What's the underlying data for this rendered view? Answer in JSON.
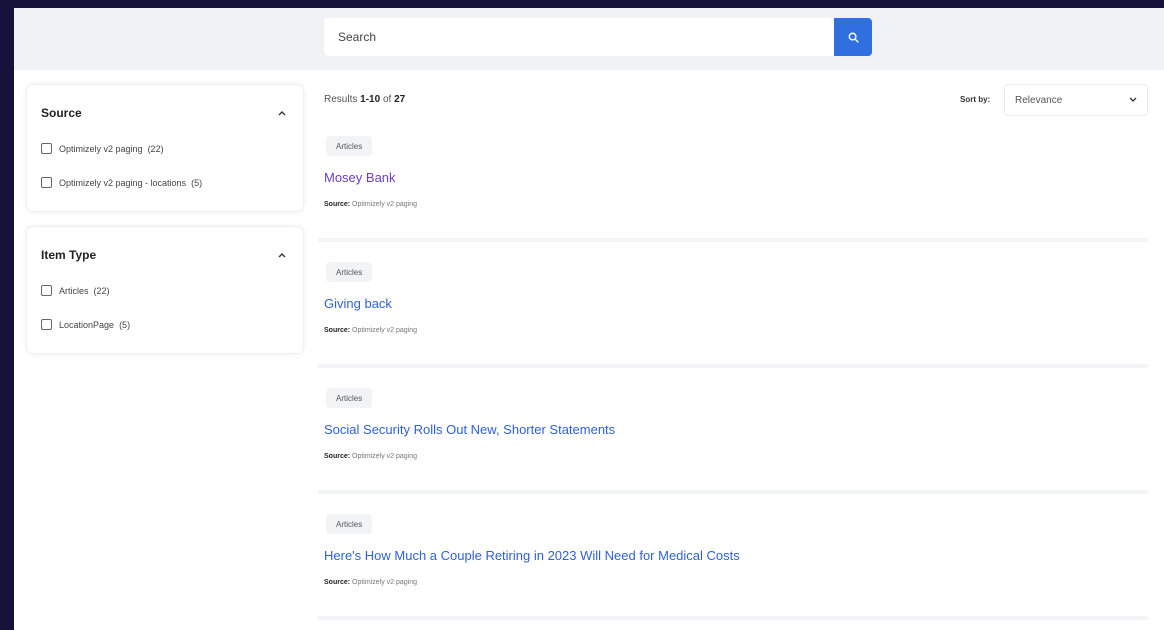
{
  "search": {
    "placeholder": "Search"
  },
  "facets": [
    {
      "title": "Source",
      "options": [
        {
          "label": "Optimizely v2 paging",
          "count": "(22)"
        },
        {
          "label": "Optimizely v2 paging - locations",
          "count": "(5)"
        }
      ]
    },
    {
      "title": "Item Type",
      "options": [
        {
          "label": "Articles",
          "count": "(22)"
        },
        {
          "label": "LocationPage",
          "count": "(5)"
        }
      ]
    }
  ],
  "results_header": {
    "prefix": "Results",
    "range": "1-10",
    "of": "of",
    "total": "27",
    "sort_label": "Sort by:",
    "sort_value": "Relevance"
  },
  "results": [
    {
      "tag": "Articles",
      "title": "Mosey Bank",
      "source_label": "Source:",
      "source_value": "Optimizely v2 paging"
    },
    {
      "tag": "Articles",
      "title": "Giving back",
      "source_label": "Source:",
      "source_value": "Optimizely v2 paging"
    },
    {
      "tag": "Articles",
      "title": "Social Security Rolls Out New, Shorter Statements",
      "source_label": "Source:",
      "source_value": "Optimizely v2 paging"
    },
    {
      "tag": "Articles",
      "title": "Here's How Much a Couple Retiring in 2023 Will Need for Medical Costs",
      "source_label": "Source:",
      "source_value": "Optimizely v2 paging"
    }
  ],
  "colors": {
    "accent": "#2f6fe0",
    "link": "#2f61d6",
    "visited_link": "#6a3fc0",
    "background_outer": "#14123a"
  },
  "icons": {
    "search_button": "search-icon",
    "facet_toggle": "chevron-up-icon",
    "sort_dropdown": "chevron-down-icon"
  }
}
